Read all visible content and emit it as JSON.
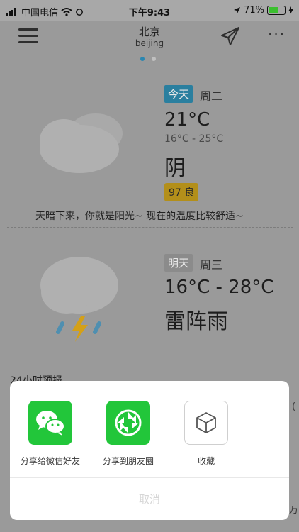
{
  "status_bar": {
    "carrier": "中国电信",
    "time": "下午9:43",
    "battery": "71%",
    "battery_level": 0.71
  },
  "header": {
    "city": "北京",
    "city_en": "beijing"
  },
  "today": {
    "tag": "今天",
    "weekday": "周二",
    "temp": "21°C",
    "range": "16°C - 25°C",
    "condition": "阴",
    "aqi": "97 良",
    "tip": "天暗下来，你就是阳光~  现在的温度比较舒适~"
  },
  "tomorrow": {
    "tag": "明天",
    "weekday": "周三",
    "range": "16°C - 28°C",
    "condition": "雷阵雨"
  },
  "hourly": {
    "title": "24小时预报",
    "edge_char1": "(",
    "edge_char2": "万"
  },
  "share_sheet": {
    "items": [
      {
        "label": "分享给微信好友",
        "icon": "wechat-icon"
      },
      {
        "label": "分享到朋友圈",
        "icon": "moments-icon"
      },
      {
        "label": "收藏",
        "icon": "cube-icon"
      }
    ],
    "cancel": "取消"
  },
  "colors": {
    "wechat_green": "#22c63a",
    "today_tag": "#2a7f9f",
    "aqi": "#b38f1a"
  }
}
